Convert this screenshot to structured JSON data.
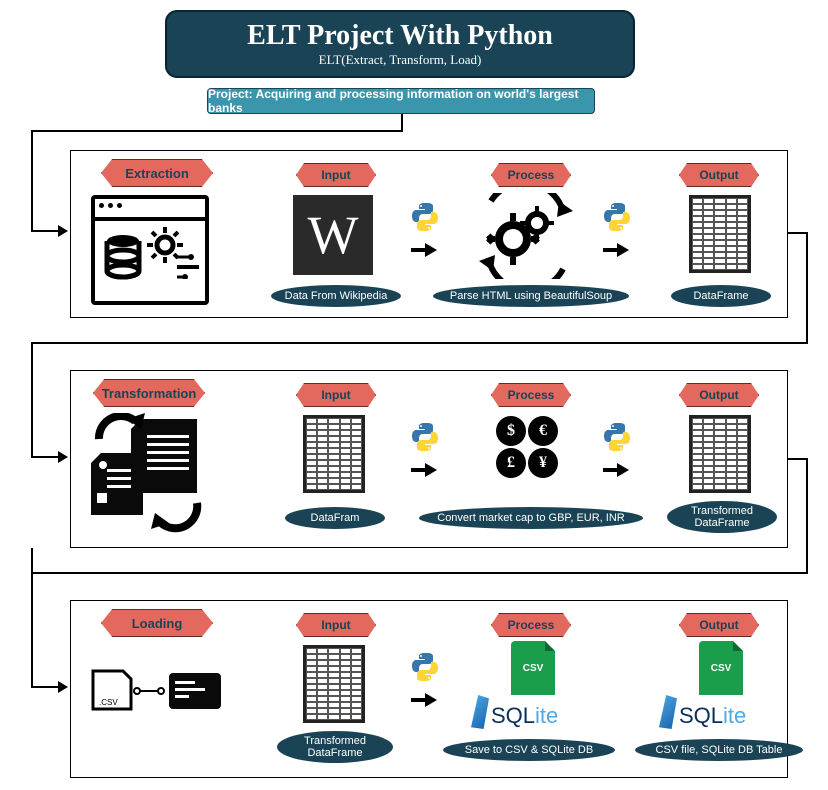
{
  "header": {
    "title": "ELT Project With Python",
    "subtitle": "ELT(Extract, Transform, Load)"
  },
  "project_bar": "Project: Acquiring and processing information on world's largest banks",
  "stages": {
    "extraction": {
      "name": "Extraction",
      "input_label": "Input",
      "process_label": "Process",
      "output_label": "Output",
      "input_caption": "Data From Wikipedia",
      "process_caption": "Parse HTML using BeautifulSoup",
      "output_caption": "DataFrame"
    },
    "transformation": {
      "name": "Transformation",
      "input_label": "Input",
      "process_label": "Process",
      "output_label": "Output",
      "input_caption": "DataFram",
      "process_caption": "Convert market cap to GBP, EUR, INR",
      "output_caption": "Transformed DataFrame"
    },
    "loading": {
      "name": "Loading",
      "input_label": "Input",
      "process_label": "Process",
      "output_label": "Output",
      "input_caption": "Transformed DataFrame",
      "process_caption": "Save to CSV & SQLite DB",
      "output_caption": "CSV file, SQLite DB Table"
    }
  },
  "icons": {
    "wikipedia_letter": "W",
    "currencies": [
      "$",
      "€",
      "£",
      "¥"
    ],
    "csv_label": "CSV",
    "sqlite_part1": "SQL",
    "sqlite_part2": "ite"
  }
}
